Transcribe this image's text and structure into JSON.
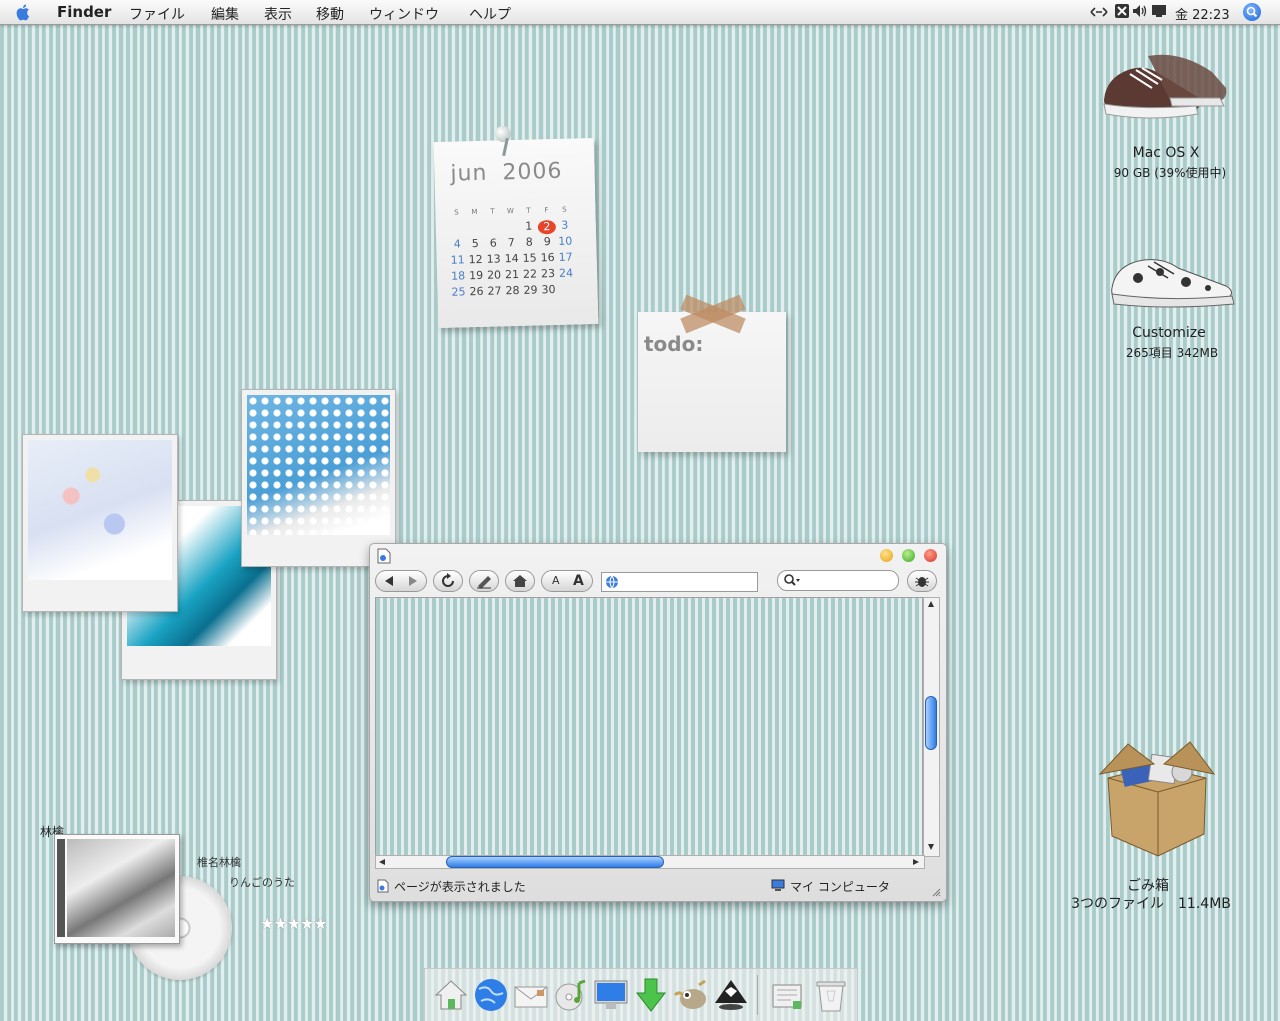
{
  "menubar": {
    "app": "Finder",
    "items": [
      "ファイル",
      "編集",
      "表示",
      "移動",
      "ウィンドウ",
      "ヘルプ"
    ],
    "clock": "金 22:23"
  },
  "calendar": {
    "month": "jun",
    "year": "2006",
    "weekdays": [
      "S",
      "M",
      "T",
      "W",
      "T",
      "F",
      "S"
    ],
    "weeks": [
      [
        "",
        "",
        "",
        "",
        "1",
        "2",
        "3"
      ],
      [
        "4",
        "5",
        "6",
        "7",
        "8",
        "9",
        "10"
      ],
      [
        "11",
        "12",
        "13",
        "14",
        "15",
        "16",
        "17"
      ],
      [
        "18",
        "19",
        "20",
        "21",
        "22",
        "23",
        "24"
      ],
      [
        "25",
        "26",
        "27",
        "28",
        "29",
        "30",
        ""
      ]
    ],
    "today": "2"
  },
  "todo": {
    "label": "todo:"
  },
  "browser": {
    "status": "ページが表示されました",
    "zone": "マイ コンピュータ",
    "text_small": "A",
    "text_large": "A"
  },
  "desktop": {
    "drive1": {
      "name": "Mac OS X",
      "info": "90 GB (39%使用中)"
    },
    "drive2": {
      "name": "Customize",
      "info": "265項目 342MB"
    },
    "trash": {
      "name": "ごみ箱",
      "info": "3つのファイル　11.4MB"
    }
  },
  "music": {
    "album": "林檎",
    "artist": "椎名林檎",
    "song": "りんごのうた",
    "rating": "★★★★★"
  },
  "colors": {
    "accent": "#1d62d9",
    "today": "#e8442a",
    "stripe_dark": "#a9cccb",
    "stripe_light": "#e3efee"
  }
}
